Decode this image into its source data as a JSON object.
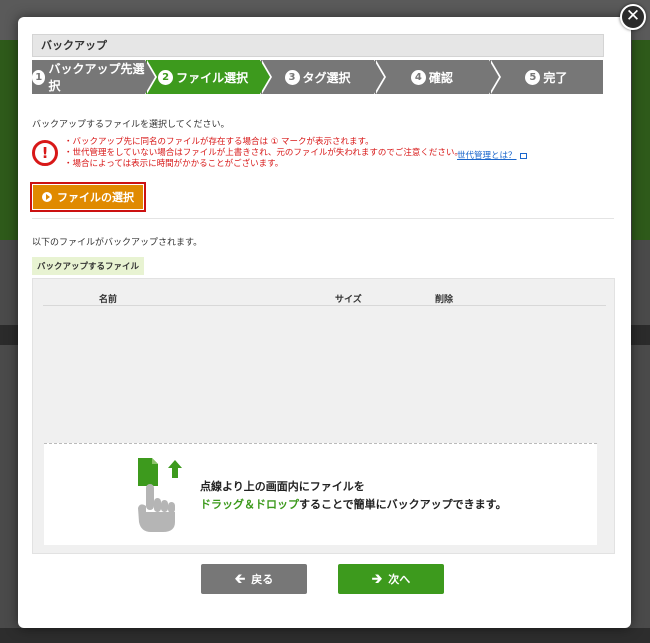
{
  "dialog": {
    "title": "バックアップ",
    "close_glyph": "✕"
  },
  "steps": [
    {
      "num": "1",
      "label": "バックアップ先選択",
      "active": false
    },
    {
      "num": "2",
      "label": "ファイル選択",
      "active": true
    },
    {
      "num": "3",
      "label": "タグ選択",
      "active": false
    },
    {
      "num": "4",
      "label": "確認",
      "active": false
    },
    {
      "num": "5",
      "label": "完了",
      "active": false
    }
  ],
  "intro_text": "バックアップするファイルを選択してください。",
  "warning": {
    "icon": "!",
    "line1": "・バックアップ先に同名のファイルが存在する場合は ① マークが表示されます。",
    "line2": "・世代管理をしていない場合はファイルが上書きされ、元のファイルが失われますのでご注意ください。",
    "line3": "・場合によっては表示に時間がかかることがございます。",
    "link": "世代管理とは？"
  },
  "select_button": "ファイルの選択",
  "below_text": "以下のファイルがバックアップされます。",
  "file_badge": "バックアップするファイル",
  "list": {
    "col_name": "名前",
    "col_size": "サイズ",
    "col_delete": "削除"
  },
  "drop": {
    "line1": "点線より上の画面内にファイルを",
    "line2_accent": "ドラッグ＆ドロップ",
    "line2_rest": "することで簡単にバックアップできます。"
  },
  "buttons": {
    "back": "戻る",
    "next": "次へ"
  },
  "colors": {
    "accent_green": "#3d9a1d",
    "step_grey": "#777777",
    "warning_red": "#d81818",
    "select_orange": "#e08a00"
  }
}
